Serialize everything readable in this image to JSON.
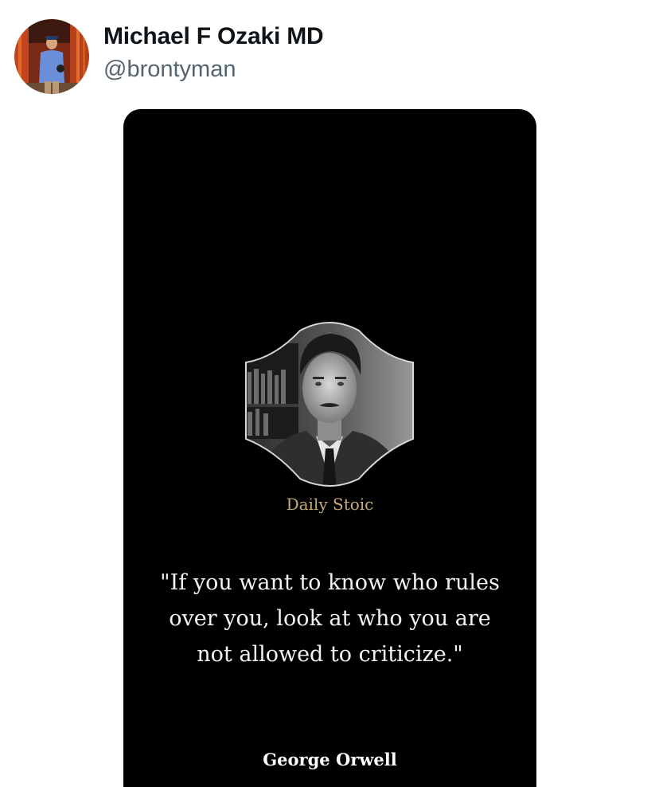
{
  "post": {
    "author": {
      "display_name": "Michael F Ozaki MD",
      "handle": "@brontyman"
    },
    "media": {
      "brand": "Daily Stoic",
      "quote": "\"If you want to know who rules over you, look at who you are not allowed to criticize.\"",
      "author": "George Orwell",
      "background_color": "#000000",
      "brand_color": "#c9a97b"
    }
  }
}
